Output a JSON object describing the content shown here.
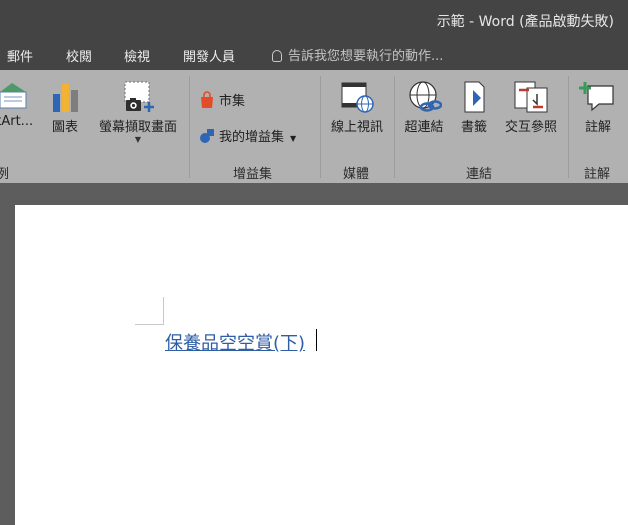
{
  "window": {
    "title": "示範 - Word (產品啟動失敗)"
  },
  "tabs": [
    "郵件",
    "校閱",
    "檢視",
    "開發人員"
  ],
  "tell_me": {
    "placeholder": "告訴我您想要執行的動作..."
  },
  "ribbon": {
    "illustrations": {
      "smartart_partial": "rtArt...",
      "chart": "圖表",
      "screenshot": "螢幕擷取畫面",
      "group_partial": "例"
    },
    "addins": {
      "store": "市集",
      "my_addins": "我的增益集",
      "label": "增益集"
    },
    "media": {
      "online_video": "線上視訊",
      "label": "媒體"
    },
    "links": {
      "hyperlink": "超連結",
      "bookmark": "書籤",
      "cross_reference": "交互參照",
      "label": "連結"
    },
    "comments": {
      "comment": "註解",
      "label": "註解"
    }
  },
  "document": {
    "link_text": "保養品空空賞(下)"
  },
  "colors": {
    "titlebar": "#444444",
    "ribbon": "#b1b1b1",
    "canvas": "#5d5d5d",
    "link": "#2f5ea5"
  }
}
